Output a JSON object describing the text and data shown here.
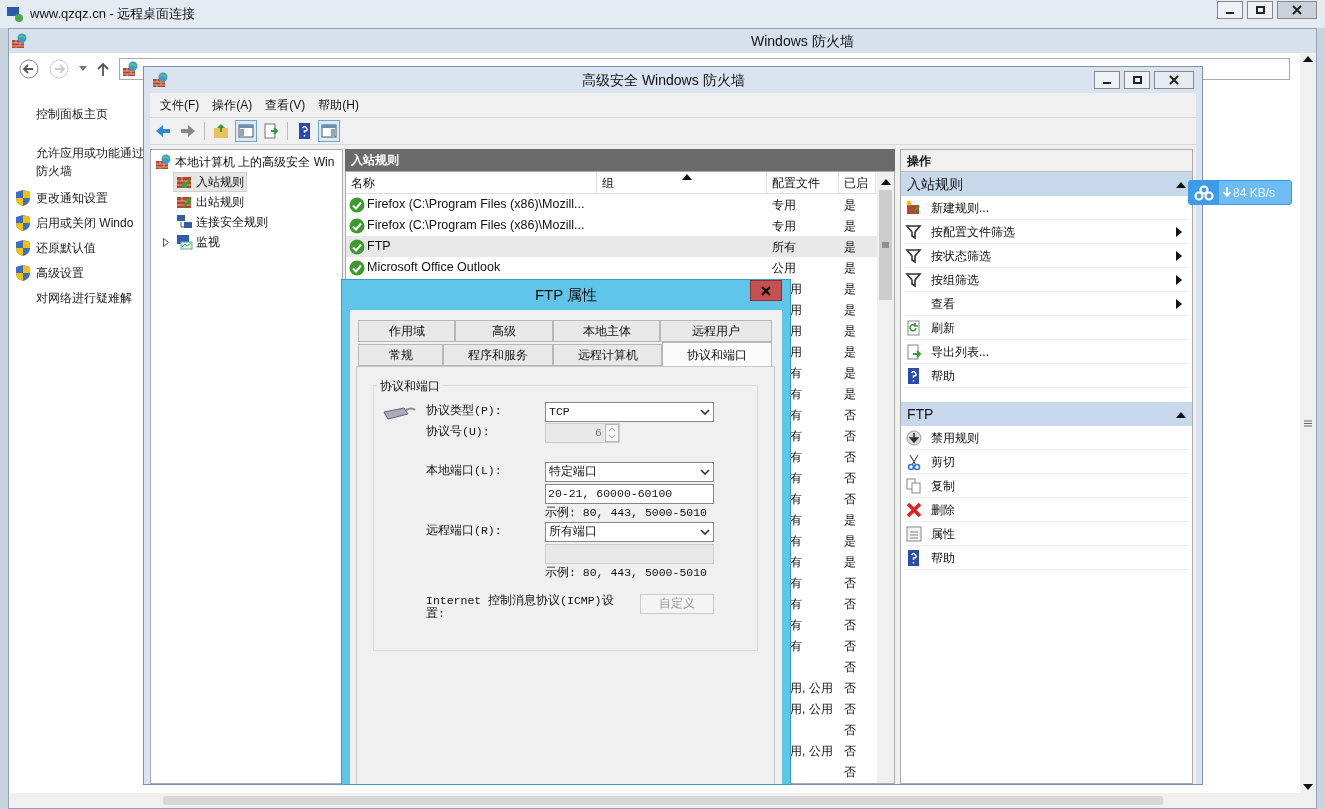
{
  "rdp_window": {
    "title": "www.qzqz.cn - 远程桌面连接"
  },
  "firewall_window": {
    "title": "Windows 防火墙",
    "sidebar": [
      {
        "label": "控制面板主页",
        "kind": "link"
      },
      {
        "label": "允许应用或功能通过防火墙",
        "kind": "link"
      },
      {
        "label": "更改通知设置",
        "kind": "shield"
      },
      {
        "label": "启用或关闭 Windo",
        "kind": "shield"
      },
      {
        "label": "还原默认值",
        "kind": "shield"
      },
      {
        "label": "高级设置",
        "kind": "shield"
      },
      {
        "label": "对网络进行疑难解",
        "kind": "link"
      }
    ]
  },
  "mmc_window": {
    "title": "高级安全 Windows 防火墙",
    "menu": [
      "文件(F)",
      "操作(A)",
      "查看(V)",
      "帮助(H)"
    ],
    "toolbar": [
      {
        "kind": "back",
        "selected": false
      },
      {
        "kind": "forward",
        "selected": false
      },
      {
        "kind": "up",
        "selected": false
      },
      {
        "kind": "tree",
        "selected": true
      },
      {
        "kind": "export",
        "selected": false
      },
      {
        "kind": "help",
        "selected": false
      },
      {
        "kind": "actions",
        "selected": true
      }
    ],
    "tree": {
      "label": "本地计算机 上的高级安全 Win",
      "children": [
        {
          "label": "入站规则",
          "selected": true,
          "kind": "leaf"
        },
        {
          "label": "出站规则",
          "selected": false,
          "kind": "leaf"
        },
        {
          "label": "连接安全规则",
          "selected": false,
          "kind": "leaf"
        },
        {
          "label": "监视",
          "selected": false,
          "kind": "expandable"
        }
      ]
    },
    "rules": {
      "title": "入站规则",
      "columns": [
        {
          "label": "名称",
          "sorted": false
        },
        {
          "label": "组",
          "sorted": true
        },
        {
          "label": "配置文件",
          "sorted": false
        },
        {
          "label": "已启",
          "sorted": false
        }
      ],
      "rows": [
        {
          "kind": "full",
          "name": "Firefox (C:\\Program Files (x86)\\Mozill...",
          "profile": "专用",
          "enabled": "是",
          "selected": false
        },
        {
          "kind": "full",
          "name": "Firefox (C:\\Program Files (x86)\\Mozill...",
          "profile": "专用",
          "enabled": "是",
          "selected": false
        },
        {
          "kind": "full",
          "name": "FTP",
          "profile": "所有",
          "enabled": "是",
          "selected": true
        },
        {
          "kind": "full",
          "name": "Microsoft Office Outlook",
          "profile": "公用",
          "enabled": "是",
          "selected": false
        },
        {
          "kind": "covered",
          "profile": "用",
          "enabled": "是",
          "selected": false
        },
        {
          "kind": "covered",
          "profile": "用",
          "enabled": "是",
          "selected": false
        },
        {
          "kind": "covered",
          "profile": "用",
          "enabled": "是",
          "selected": false
        },
        {
          "kind": "covered",
          "profile": "用",
          "enabled": "是",
          "selected": false
        },
        {
          "kind": "covered",
          "profile": "有",
          "enabled": "是",
          "selected": false
        },
        {
          "kind": "covered",
          "profile": "有",
          "enabled": "是",
          "selected": false
        },
        {
          "kind": "covered",
          "profile": "有",
          "enabled": "否",
          "selected": false
        },
        {
          "kind": "covered",
          "profile": "有",
          "enabled": "否",
          "selected": false
        },
        {
          "kind": "covered",
          "profile": "有",
          "enabled": "否",
          "selected": false
        },
        {
          "kind": "covered",
          "profile": "有",
          "enabled": "否",
          "selected": false
        },
        {
          "kind": "covered",
          "profile": "有",
          "enabled": "否",
          "selected": false
        },
        {
          "kind": "covered",
          "profile": "有",
          "enabled": "是",
          "selected": false
        },
        {
          "kind": "covered",
          "profile": "有",
          "enabled": "是",
          "selected": false
        },
        {
          "kind": "covered",
          "profile": "有",
          "enabled": "是",
          "selected": false
        },
        {
          "kind": "covered",
          "profile": "有",
          "enabled": "否",
          "selected": false
        },
        {
          "kind": "covered",
          "profile": "有",
          "enabled": "否",
          "selected": false
        },
        {
          "kind": "covered",
          "profile": "有",
          "enabled": "否",
          "selected": false
        },
        {
          "kind": "covered",
          "profile": "有",
          "enabled": "否",
          "selected": false
        },
        {
          "kind": "covered",
          "enabled": "否",
          "selected": false
        },
        {
          "kind": "covered",
          "profile": "用, 公用",
          "enabled": "否",
          "selected": false
        },
        {
          "kind": "covered",
          "profile": "用, 公用",
          "enabled": "否",
          "selected": false
        },
        {
          "kind": "covered",
          "enabled": "否",
          "selected": false
        },
        {
          "kind": "covered",
          "profile": "用, 公用",
          "enabled": "否",
          "selected": false
        },
        {
          "kind": "covered",
          "enabled": "否",
          "selected": false
        }
      ]
    },
    "actions": {
      "title": "操作",
      "sections": [
        {
          "title": "入站规则",
          "expanded": true,
          "items": [
            {
              "label": "新建规则...",
              "submenu": false
            },
            {
              "label": "按配置文件筛选",
              "submenu": true
            },
            {
              "label": "按状态筛选",
              "submenu": true
            },
            {
              "label": "按组筛选",
              "submenu": true
            },
            {
              "label": "查看",
              "submenu": true
            },
            {
              "label": "刷新",
              "submenu": false
            },
            {
              "label": "导出列表...",
              "submenu": false
            },
            {
              "label": "帮助",
              "submenu": false
            }
          ]
        },
        {
          "title": "FTP",
          "expanded": true,
          "items": [
            {
              "label": "禁用规则",
              "submenu": false
            },
            {
              "label": "剪切",
              "submenu": false
            },
            {
              "label": "复制",
              "submenu": false
            },
            {
              "label": "删除",
              "submenu": false
            },
            {
              "label": "属性",
              "submenu": false
            },
            {
              "label": "帮助",
              "submenu": false
            }
          ]
        }
      ]
    }
  },
  "dialog": {
    "title": "FTP 属性",
    "tabs_row1": [
      {
        "label": "作用域",
        "selected": false
      },
      {
        "label": "高级",
        "selected": false
      },
      {
        "label": "本地主体",
        "selected": false
      },
      {
        "label": "远程用户",
        "selected": false
      }
    ],
    "tabs_row2": [
      {
        "label": "常规",
        "selected": false
      },
      {
        "label": "程序和服务",
        "selected": false
      },
      {
        "label": "远程计算机",
        "selected": false
      },
      {
        "label": "协议和端口",
        "selected": true
      }
    ],
    "group_title": "协议和端口",
    "protocol_type": {
      "label": "协议类型(P):",
      "value": "TCP"
    },
    "protocol_number": {
      "label": "协议号(U):",
      "value": "6",
      "disabled": true
    },
    "local_port": {
      "label": "本地端口(L):",
      "value": "特定端口",
      "ports": "20-21, 60000-60100",
      "disabled": false,
      "example": "示例: 80, 443, 5000-5010"
    },
    "remote_port": {
      "label": "远程端口(R):",
      "value": "所有端口",
      "disabled": true,
      "example": "示例: 80, 443, 5000-5010"
    },
    "icmp": {
      "label": "Internet 控制消息协议(ICMP)设置:",
      "button": "自定义",
      "disabled": true
    }
  },
  "speed_widget": {
    "speed": "84 KB/s"
  }
}
